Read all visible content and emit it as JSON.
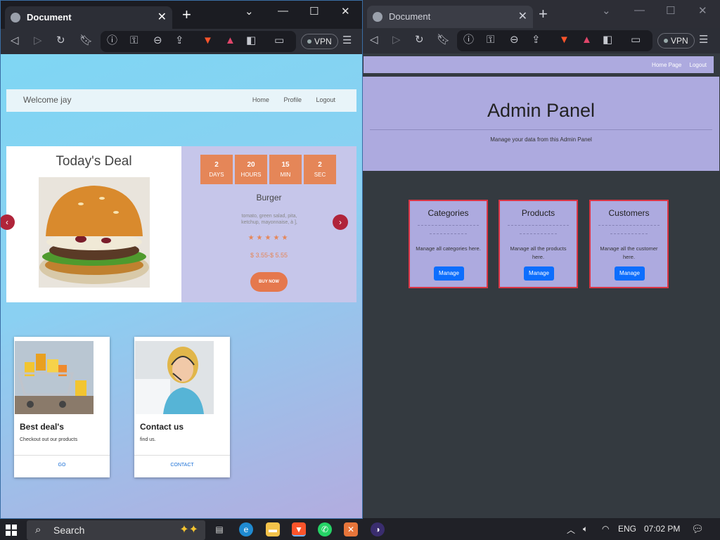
{
  "browser_left": {
    "tab_title": "Document",
    "vpn_label": "VPN",
    "nav": {
      "welcome": "Welcome jay",
      "links": [
        "Home",
        "Profile",
        "Logout"
      ]
    },
    "deal": {
      "title": "Today's Deal",
      "countdown": [
        {
          "num": "2",
          "unit": "DAYS"
        },
        {
          "num": "20",
          "unit": "HOURS"
        },
        {
          "num": "15",
          "unit": "MIN"
        },
        {
          "num": "2",
          "unit": "SEC"
        }
      ],
      "product": "Burger",
      "description": "tomato, green salad, pita, ketchup, mayonnaise, à ],",
      "stars": "★★★★★",
      "price": "$ 3.55-$ 5.55",
      "buy_label": "BUY NOW"
    },
    "cards": [
      {
        "title": "Best deal's",
        "subtitle": "Checkout out our products",
        "action": "GO"
      },
      {
        "title": "Contact us",
        "subtitle": "find us.",
        "action": "CONTACT"
      }
    ]
  },
  "browser_right": {
    "tab_title": "Document",
    "vpn_label": "VPN",
    "nav_links": [
      "Home Page",
      "Logout"
    ],
    "hero": {
      "title": "Admin Panel",
      "subtitle": "Manage your data from this Admin Panel"
    },
    "cards": [
      {
        "title": "Categories",
        "desc": "Manage all categories here.",
        "button": "Manage"
      },
      {
        "title": "Products",
        "desc": "Manage all the products here.",
        "button": "Manage"
      },
      {
        "title": "Customers",
        "desc": "Manage all the customer here.",
        "button": "Manage"
      }
    ]
  },
  "taskbar": {
    "search_label": "Search",
    "language": "ENG",
    "time": "07:02 PM"
  },
  "colors": {
    "deal_accent": "#e58658",
    "admin_card_border": "#dc3545",
    "manage_button": "#0d6efd"
  }
}
